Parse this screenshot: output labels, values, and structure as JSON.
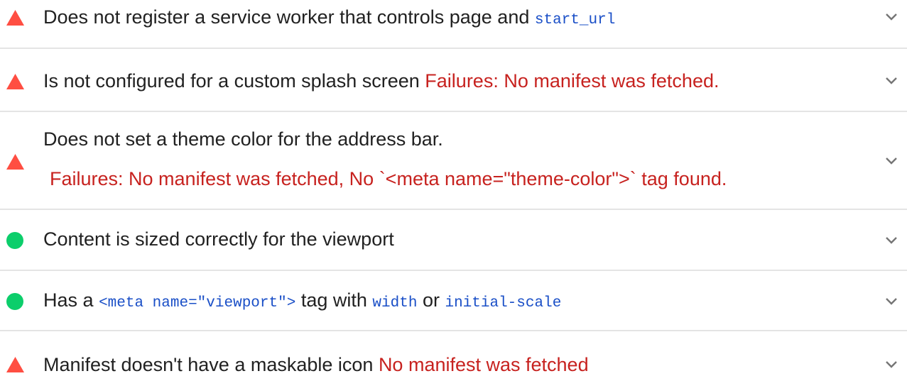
{
  "colors": {
    "fail": "#ff4e42",
    "pass": "#0cce6b",
    "error_text": "#c7221f",
    "code_text": "#1a4fc7",
    "divider": "#e4e4e4"
  },
  "audits": [
    {
      "status": "fail",
      "title": "Does not register a service worker that controls page and",
      "code": "start_url"
    },
    {
      "status": "fail",
      "title": "Is not configured for a custom splash screen",
      "failure": "Failures: No manifest was fetched."
    },
    {
      "status": "fail",
      "title": "Does not set a theme color for the address bar.",
      "failure": "Failures: No manifest was fetched, No `<meta name=\"theme-color\">` tag found."
    },
    {
      "status": "pass",
      "title": "Content is sized correctly for the viewport"
    },
    {
      "status": "pass",
      "title_parts": [
        "Has a",
        "<meta name=\"viewport\">",
        "tag with",
        "width",
        "or",
        "initial-scale"
      ]
    },
    {
      "status": "fail",
      "title": "Manifest doesn't have a maskable icon",
      "failure": "No manifest was fetched"
    }
  ],
  "icons": {
    "fail": "warning-triangle-icon",
    "pass": "pass-circle-icon",
    "expand": "chevron-down-icon"
  }
}
